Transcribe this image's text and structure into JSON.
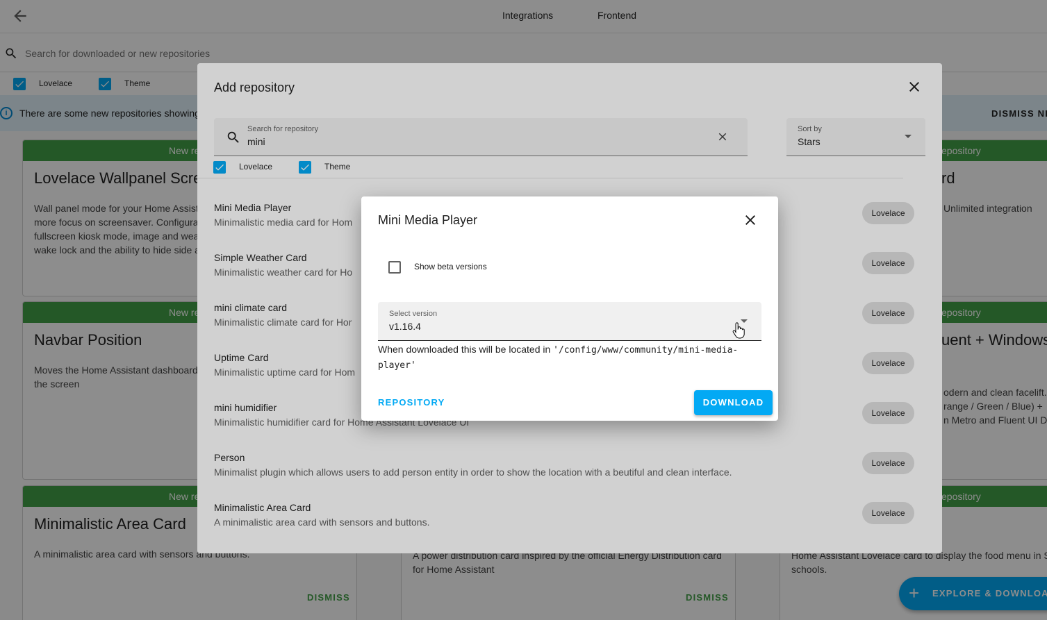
{
  "topbar": {
    "tabs": [
      "Integrations",
      "Frontend"
    ]
  },
  "search": {
    "placeholder": "Search for downloaded or new repositories"
  },
  "filters": [
    "Lovelace",
    "Theme"
  ],
  "info_banner": {
    "text": "There are some new repositories showing",
    "dismiss": "DISMISS NE"
  },
  "cards": [
    {
      "band": "New repo",
      "title": "Lovelace Wallpanel Scre",
      "desc": [
        "Wall panel mode for your Home Assist",
        "more focus on screensaver. Configura",
        "fullscreen kiosk mode, image and wea",
        "wake lock and the ability to hide side a"
      ]
    },
    {
      "band": "New repo",
      "title": "Navbar Position",
      "desc": [
        "Moves the Home Assistant dashboard",
        "the screen"
      ]
    },
    {
      "band": "New repo",
      "title": "Minimalistic Area Card",
      "desc": [
        "A minimalistic area card with sensors and buttons."
      ],
      "dismiss": "DISMISS"
    },
    {
      "band": "epository",
      "title": "rd",
      "desc": [
        "Unlimited integration"
      ]
    },
    {
      "band": "epository",
      "title": "uent + Windows",
      "desc": [
        "odern and clean facelift.",
        "range / Green / Blue) +",
        "n Metro and Fluent UI De"
      ]
    },
    {
      "band": "epository",
      "title": "",
      "desc": []
    },
    {
      "desc": [
        "A power distribution card inspired by the official Energy Distribution card",
        "for Home Assistant"
      ],
      "dismiss": "DISMISS"
    },
    {
      "desc": [
        "Home Assistant Lovelace card to display the food menu in S",
        "schools."
      ]
    }
  ],
  "fab": {
    "label": "EXPLORE & DOWNLOAD"
  },
  "add_repo_dialog": {
    "title": "Add repository",
    "search": {
      "label": "Search for repository",
      "value": "mini"
    },
    "sort": {
      "label": "Sort by",
      "value": "Stars"
    },
    "filters": [
      "Lovelace",
      "Theme"
    ],
    "repos": [
      {
        "name": "Mini Media Player",
        "desc": "Minimalistic media card for Hom",
        "category": "Lovelace"
      },
      {
        "name": "Simple Weather Card",
        "desc": "Minimalistic weather card for Ho",
        "category": "Lovelace"
      },
      {
        "name": "mini climate card",
        "desc": "Minimalistic climate card for Hor",
        "category": "Lovelace"
      },
      {
        "name": "Uptime Card",
        "desc": "Minimalistic uptime card for Hom",
        "category": "Lovelace"
      },
      {
        "name": "mini humidifier",
        "desc": "Minimalistic humidifier card for Home Assistant Lovelace UI",
        "category": "Lovelace"
      },
      {
        "name": "Person",
        "desc": "Minimalist plugin which allows users to add person entity in order to show the location with a beutiful and clean interface.",
        "category": "Lovelace"
      },
      {
        "name": "Minimalistic Area Card",
        "desc": "A minimalistic area card with sensors and buttons.",
        "category": "Lovelace"
      }
    ]
  },
  "download_dialog": {
    "title": "Mini Media Player",
    "beta_label": "Show beta versions",
    "beta_checked": false,
    "version": {
      "label": "Select version",
      "value": "v1.16.4"
    },
    "note_prefix": "When downloaded this will be located in ",
    "note_path_1": "'/config/www/community/mini-media-",
    "note_path_2": "player'",
    "repository_button": "REPOSITORY",
    "download_button": "DOWNLOAD"
  },
  "colors": {
    "accent": "#03a9f4",
    "new_band": "#43a047"
  }
}
